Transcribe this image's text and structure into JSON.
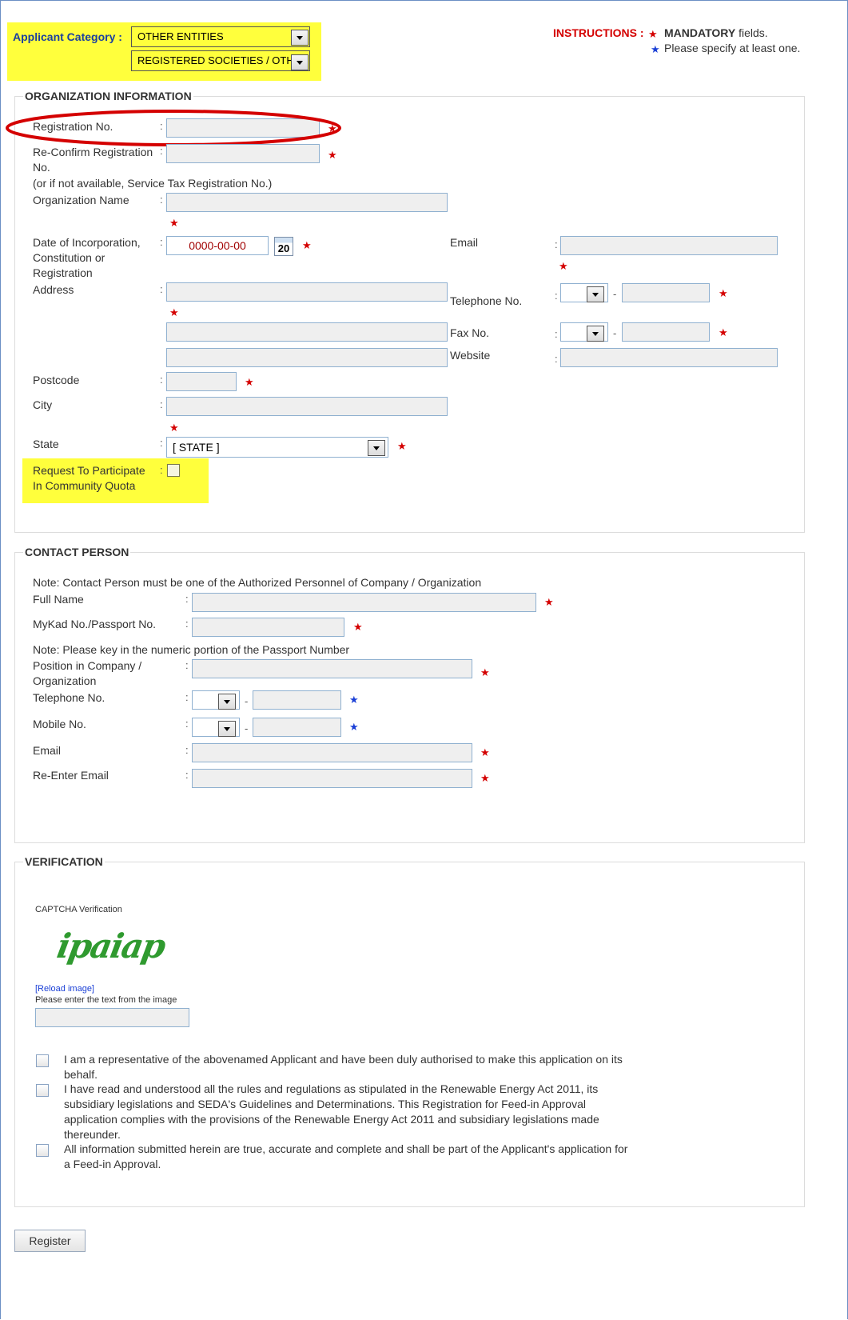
{
  "applicant_category": {
    "label": "Applicant Category :",
    "category_value": "OTHER ENTITIES",
    "subcategory_value": "REGISTERED SOCIETIES / OTH"
  },
  "instructions": {
    "title": "INSTRUCTIONS :",
    "mandatory_bold": "MANDATORY",
    "mandatory_rest": " fields.",
    "specify": "Please specify at least one."
  },
  "org": {
    "legend": "ORGANIZATION INFORMATION",
    "registration_no": "Registration No.",
    "reconfirm_line1": "Re-Confirm Registration",
    "reconfirm_line2": "No.",
    "reconfirm_note": "(or if not available, Service Tax Registration No.)",
    "org_name": "Organization Name",
    "doi_line1": "Date of Incorporation,",
    "doi_line2": "Constitution or",
    "doi_line3": "Registration",
    "doi_value": "0000-00-00",
    "calendar_day": "20",
    "email": "Email",
    "address": "Address",
    "telephone": "Telephone No.",
    "fax": "Fax No.",
    "website": "Website",
    "postcode": "Postcode",
    "city": "City",
    "state": "State",
    "state_value": "[ STATE ]",
    "quota_line1": "Request To Participate",
    "quota_line2": "In Community Quota"
  },
  "contact": {
    "legend": "CONTACT PERSON",
    "note1": "Note: Contact Person must be one of the Authorized Personnel of Company / Organization",
    "full_name": "Full Name",
    "mykad": "MyKad No./Passport No.",
    "note2": "Note: Please key in the numeric portion of the Passport Number",
    "position_line1": "Position in Company /",
    "position_line2": "Organization",
    "telephone": "Telephone No.",
    "mobile": "Mobile No.",
    "email": "Email",
    "reenter_email": "Re-Enter Email"
  },
  "verification": {
    "legend": "VERIFICATION",
    "captcha_title": "CAPTCHA Verification",
    "captcha_text": "ipaiap",
    "reload": "[Reload image]",
    "enter_text": "Please enter the text from the image",
    "decl1": "I am a representative of the abovenamed Applicant and have been duly authorised to make this application on its behalf.",
    "decl2": "I have read and understood all the rules and regulations as stipulated in the Renewable Energy Act 2011, its subsidiary legislations and SEDA's Guidelines and Determinations. This Registration for Feed-in Approval application complies with the provisions of the Renewable Energy Act 2011 and subsidiary legislations made thereunder.",
    "decl3": "All information submitted herein are true, accurate and complete and shall be part of the Applicant's application for a Feed-in Approval."
  },
  "register_label": "Register",
  "colon": ":",
  "dash": "-",
  "star": "★",
  "colors": {
    "highlight": "#ffff3c",
    "required": "#d40000",
    "optional": "#1a3fd6",
    "annotation": "#d40000"
  }
}
